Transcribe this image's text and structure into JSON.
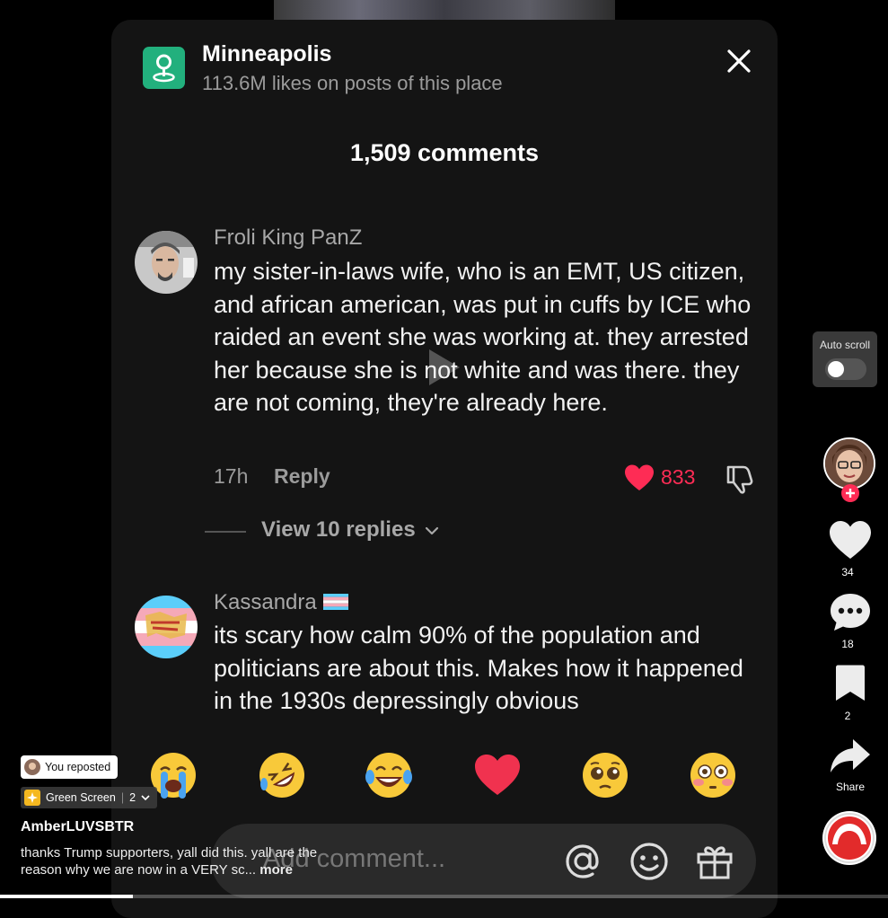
{
  "place": {
    "name": "Minneapolis",
    "subtitle": "113.6M likes on posts of this place",
    "icon": "location-pin-icon",
    "accent": "#22b07d"
  },
  "comments_header": "1,509 comments",
  "comments": [
    {
      "username": "Froli King PanZ",
      "text": "my sister-in-laws wife, who is an EMT, US citizen, and african american, was put in cuffs by ICE who raided an event she was working at. they arrested her because she is not white and was there. they are not coming, they're already here.",
      "time": "17h",
      "reply_label": "Reply",
      "likes": "833",
      "liked": true,
      "view_replies": "View 10 replies"
    },
    {
      "username": "Kassandra",
      "username_flag": "transgender-flag-emoji",
      "text": "its scary how calm 90% of the population and politicians are about this. Makes how it happened in the 1930s depressingly obvious"
    }
  ],
  "quick_emojis": [
    "loudly-crying-face",
    "rolling-on-floor-laughing",
    "face-with-tears-of-joy",
    "red-heart",
    "pleading-face",
    "flushed-face"
  ],
  "input": {
    "placeholder": "Add comment...",
    "icons": [
      "at-mention-icon",
      "emoji-icon",
      "gift-icon"
    ]
  },
  "side_rail": {
    "auto_scroll_label": "Auto scroll",
    "auto_scroll_on": false,
    "like_count": "34",
    "comment_count": "18",
    "bookmark_count": "2",
    "share_label": "Share"
  },
  "overlay": {
    "repost_label": "You reposted",
    "effect_label": "Green Screen",
    "effect_count": "2",
    "author": "AmberLUVSBTR",
    "caption": "thanks Trump supporters, yall did this. yall are the reason why we are now in a VERY sc...",
    "more_label": "more"
  },
  "colors": {
    "like_red": "#fe2c55",
    "panel_bg": "#141414"
  },
  "video_progress": 0.15
}
